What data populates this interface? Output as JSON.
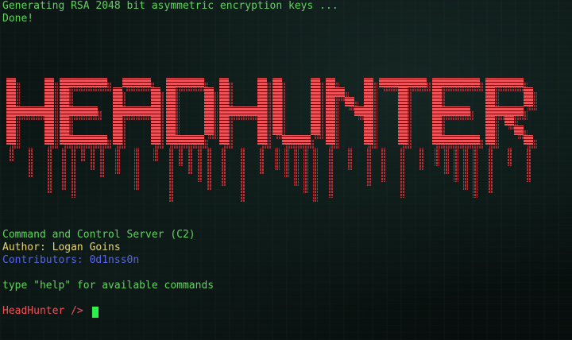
{
  "terminal": {
    "lines": {
      "generating": "Generating RSA 2048 bit asymmetric encryption keys ...",
      "done": "Done!",
      "description": "Command and Control Server (C2)",
      "author": "Author: Logan Goins",
      "contributors": "Contributors: 0d1nss0n",
      "help_hint": "type \"help\" for available commands"
    },
    "prompt": "HeadHunter /> ",
    "banner_logo_text": "HEADHUNTER"
  },
  "colors": {
    "background": "#0b1614",
    "green_text": "#5fd35f",
    "yellow_text": "#e6d36a",
    "blue_text": "#5a64e6",
    "red_text": "#f0525a",
    "banner_red": "#f0525a",
    "cursor": "#2ef04a"
  },
  "icons": {
    "cursor": "block-cursor"
  }
}
